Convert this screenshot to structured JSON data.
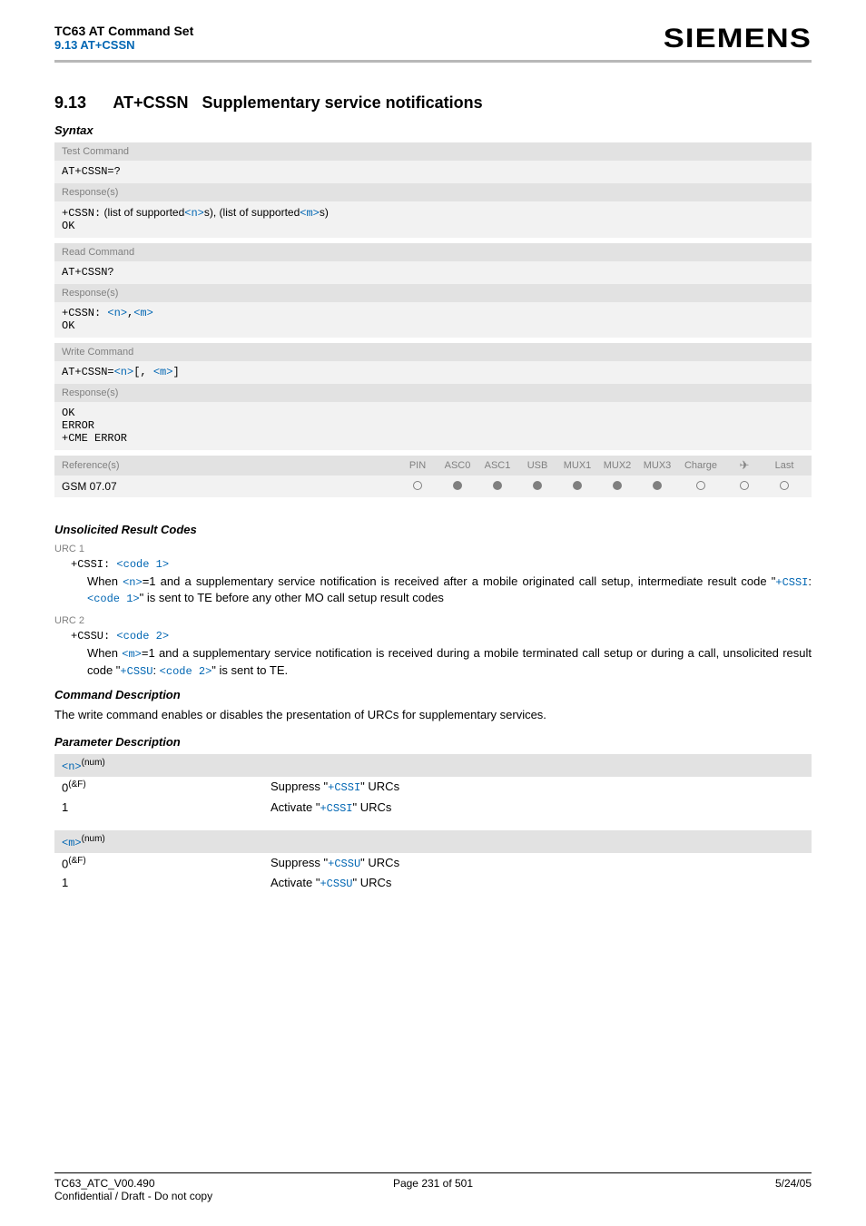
{
  "header": {
    "doc_title": "TC63 AT Command Set",
    "doc_sub": "9.13 AT+CSSN",
    "brand": "SIEMENS"
  },
  "section": {
    "number": "9.13",
    "title_cmd": "AT+CSSN",
    "title_rest": "Supplementary service notifications"
  },
  "syntax_label": "Syntax",
  "test_cmd": {
    "head": "Test Command",
    "cmd": "AT+CSSN=?",
    "resp_head": "Response(s)",
    "line1_prefix": "+CSSN:",
    "line1_text1": " (list of supported",
    "line1_n": "<n>",
    "line1_text2": "s), (list of supported",
    "line1_m": "<m>",
    "line1_text3": "s)",
    "ok": "OK"
  },
  "read_cmd": {
    "head": "Read Command",
    "cmd": "AT+CSSN?",
    "resp_head": "Response(s)",
    "line_prefix": "+CSSN: ",
    "n": "<n>",
    "comma": ",",
    "m": "<m>",
    "ok": "OK"
  },
  "write_cmd": {
    "head": "Write Command",
    "cmd_prefix": "AT+CSSN=",
    "n": "<n>",
    "br1": "[, ",
    "m": "<m>",
    "br2": "]",
    "resp_head": "Response(s)",
    "ok": "OK",
    "err": "ERROR",
    "cme": "+CME ERROR"
  },
  "ref": {
    "head": "Reference(s)",
    "cols": [
      "PIN",
      "ASC0",
      "ASC1",
      "USB",
      "MUX1",
      "MUX2",
      "MUX3",
      "Charge",
      "✈",
      "Last"
    ],
    "value": "GSM 07.07",
    "dots": [
      "empty",
      "filled",
      "filled",
      "filled",
      "filled",
      "filled",
      "filled",
      "empty",
      "empty",
      "empty"
    ]
  },
  "urc": {
    "heading": "Unsolicited Result Codes",
    "u1_label": "URC 1",
    "u1_code_prefix": "+CSSI: ",
    "u1_code_link": "<code 1>",
    "u1_desc_p1": "When ",
    "u1_n": "<n>",
    "u1_desc_p2": "=1 and a supplementary service notification is received after a mobile originated call setup, intermediate result code \"",
    "u1_cssi": "+CSSI",
    "u1_colon": ": ",
    "u1_code1": "<code 1>",
    "u1_desc_p3": "\" is sent to TE before any other MO call setup result codes",
    "u2_label": "URC 2",
    "u2_code_prefix": "+CSSU: ",
    "u2_code_link": "<code 2>",
    "u2_desc_p1": "When ",
    "u2_m": "<m>",
    "u2_desc_p2": "=1 and a supplementary service notification is received during a mobile terminated call setup or during a call, unsolicited result code \"",
    "u2_cssu": "+CSSU",
    "u2_colon": ": ",
    "u2_code2": "<code 2>",
    "u2_desc_p3": "\" is sent to TE."
  },
  "cmd_desc": {
    "heading": "Command Description",
    "text": "The write command enables or disables the presentation of URCs for supplementary services."
  },
  "param": {
    "heading": "Parameter Description",
    "n_head": "<n>",
    "num_sup": "(num)",
    "amp_f": "(&F)",
    "n0": "0",
    "n0_desc_p1": "Suppress \"",
    "n0_cssi": "+CSSI",
    "n0_desc_p2": "\" URCs",
    "n1": "1",
    "n1_desc_p1": "Activate \"",
    "n1_cssi": "+CSSI",
    "n1_desc_p2": "\" URCs",
    "m_head": "<m>",
    "m0": "0",
    "m0_desc_p1": "Suppress \"",
    "m0_cssu": "+CSSU",
    "m0_desc_p2": "\" URCs",
    "m1": "1",
    "m1_desc_p1": "Activate \"",
    "m1_cssu": "+CSSU",
    "m1_desc_p2": "\" URCs"
  },
  "footer": {
    "left1": "TC63_ATC_V00.490",
    "left2": "Confidential / Draft - Do not copy",
    "mid": "Page 231 of 501",
    "right": "5/24/05"
  }
}
